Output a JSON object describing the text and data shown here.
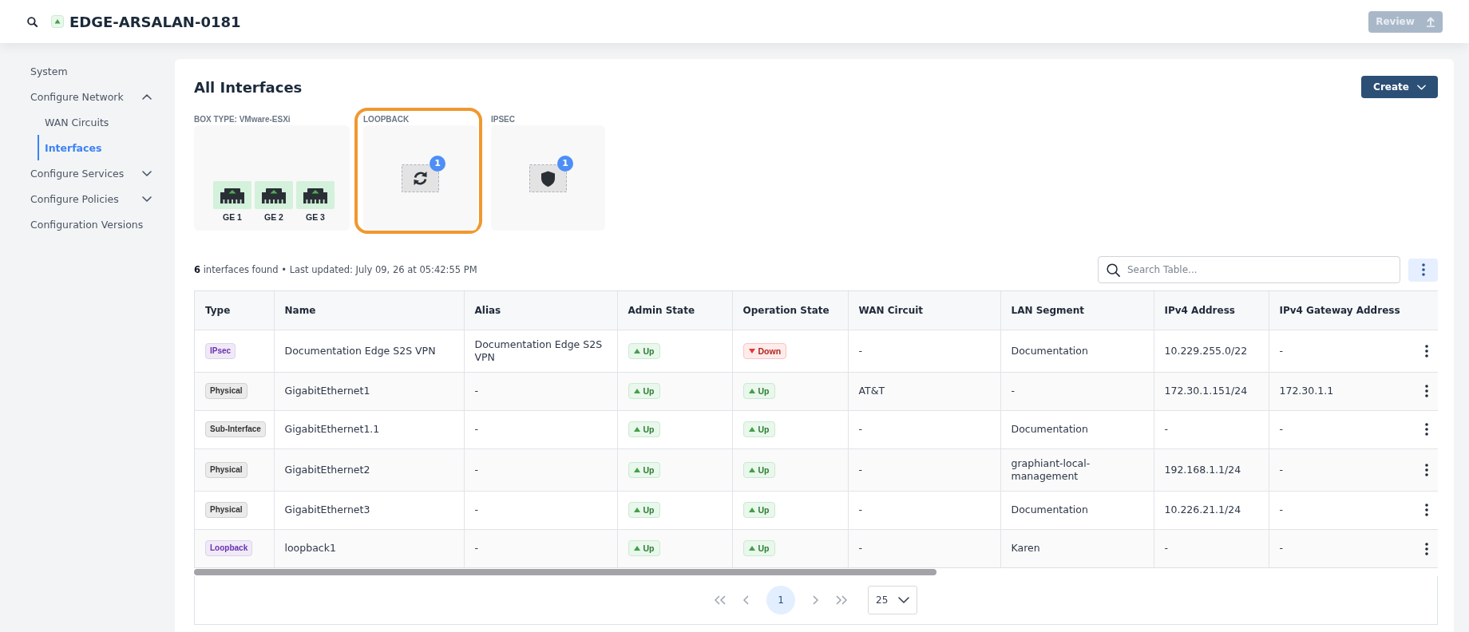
{
  "header": {
    "title": "EDGE-ARSALAN-0181",
    "up": true,
    "review_button": {
      "label": "Review",
      "disabled": true
    }
  },
  "sidebar": {
    "items": [
      {
        "label": "System",
        "selected": false
      },
      {
        "label": "Configure Network",
        "selected": false,
        "expanded": true,
        "children": [
          {
            "label": "WAN Circuits",
            "selected": false
          },
          {
            "label": "Interfaces",
            "selected": true
          }
        ]
      },
      {
        "label": "Configure Services",
        "selected": false,
        "expanded": false
      },
      {
        "label": "Configure Policies",
        "selected": false,
        "expanded": false
      },
      {
        "label": "Configuration Versions",
        "selected": false
      }
    ]
  },
  "page": {
    "title": "All Interfaces",
    "create_button": {
      "label": "Create"
    }
  },
  "interface_groups": [
    {
      "label": "BOX TYPE: VMware-ESXi",
      "kind": "ports",
      "selected": false,
      "ports": [
        {
          "label": "GE 1",
          "up": true
        },
        {
          "label": "GE 2",
          "up": true
        },
        {
          "label": "GE 3",
          "up": true
        }
      ]
    },
    {
      "label": "LOOPBACK",
      "kind": "loopback",
      "selected": true,
      "count": "1"
    },
    {
      "label": "IPSEC",
      "kind": "ipsec",
      "selected": false,
      "count": "1"
    }
  ],
  "summary": "**6** interfaces found • Last updated: July 09, 26 at 05:42:55 PM",
  "search": {
    "placeholder": "Search Table..."
  },
  "table": {
    "columns": [
      "Type",
      "Name",
      "Alias",
      "Admin State",
      "Operation State",
      "WAN Circuit",
      "LAN Segment",
      "IPv4 Address",
      "IPv4 Gateway Address"
    ],
    "rows": [
      {
        "type": {
          "label": "IPsec",
          "color": "#6b2fb0"
        },
        "name": "Documentation Edge S2S VPN",
        "alias": "Documentation Edge S2S VPN",
        "admin_state": {
          "label": "Up",
          "up": true
        },
        "operation_state": {
          "label": "Down",
          "up": false
        },
        "wan_circuit": "-",
        "lan_segment": "Documentation",
        "ipv4_address": "10.229.255.0/22",
        "ipv4_gateway_address": "-"
      },
      {
        "type": {
          "label": "Physical",
          "color": "#333333"
        },
        "name": "GigabitEthernet1",
        "alias": "-",
        "admin_state": {
          "label": "Up",
          "up": true
        },
        "operation_state": {
          "label": "Up",
          "up": true
        },
        "wan_circuit": "AT&T",
        "lan_segment": "-",
        "ipv4_address": "172.30.1.151/24",
        "ipv4_gateway_address": "172.30.1.1"
      },
      {
        "type": {
          "label": "Sub-Interface",
          "color": "#333333"
        },
        "name": "GigabitEthernet1.1",
        "alias": "-",
        "admin_state": {
          "label": "Up",
          "up": true
        },
        "operation_state": {
          "label": "Up",
          "up": true
        },
        "wan_circuit": "-",
        "lan_segment": "Documentation",
        "ipv4_address": "-",
        "ipv4_gateway_address": "-"
      },
      {
        "type": {
          "label": "Physical",
          "color": "#333333"
        },
        "name": "GigabitEthernet2",
        "alias": "-",
        "admin_state": {
          "label": "Up",
          "up": true
        },
        "operation_state": {
          "label": "Up",
          "up": true
        },
        "wan_circuit": "-",
        "lan_segment": "graphiant-local-management",
        "ipv4_address": "192.168.1.1/24",
        "ipv4_gateway_address": "-"
      },
      {
        "type": {
          "label": "Physical",
          "color": "#333333"
        },
        "name": "GigabitEthernet3",
        "alias": "-",
        "admin_state": {
          "label": "Up",
          "up": true
        },
        "operation_state": {
          "label": "Up",
          "up": true
        },
        "wan_circuit": "-",
        "lan_segment": "Documentation",
        "ipv4_address": "10.226.21.1/24",
        "ipv4_gateway_address": "-"
      },
      {
        "type": {
          "label": "Loopback",
          "color": "#6b2fb0"
        },
        "name": "loopback1",
        "alias": "-",
        "admin_state": {
          "label": "Up",
          "up": true
        },
        "operation_state": {
          "label": "Up",
          "up": true
        },
        "wan_circuit": "-",
        "lan_segment": "Karen",
        "ipv4_address": "-",
        "ipv4_gateway_address": "-"
      }
    ]
  },
  "pagination": {
    "pages": [
      {
        "label": "1",
        "selected": true
      }
    ],
    "page_size": "25"
  }
}
